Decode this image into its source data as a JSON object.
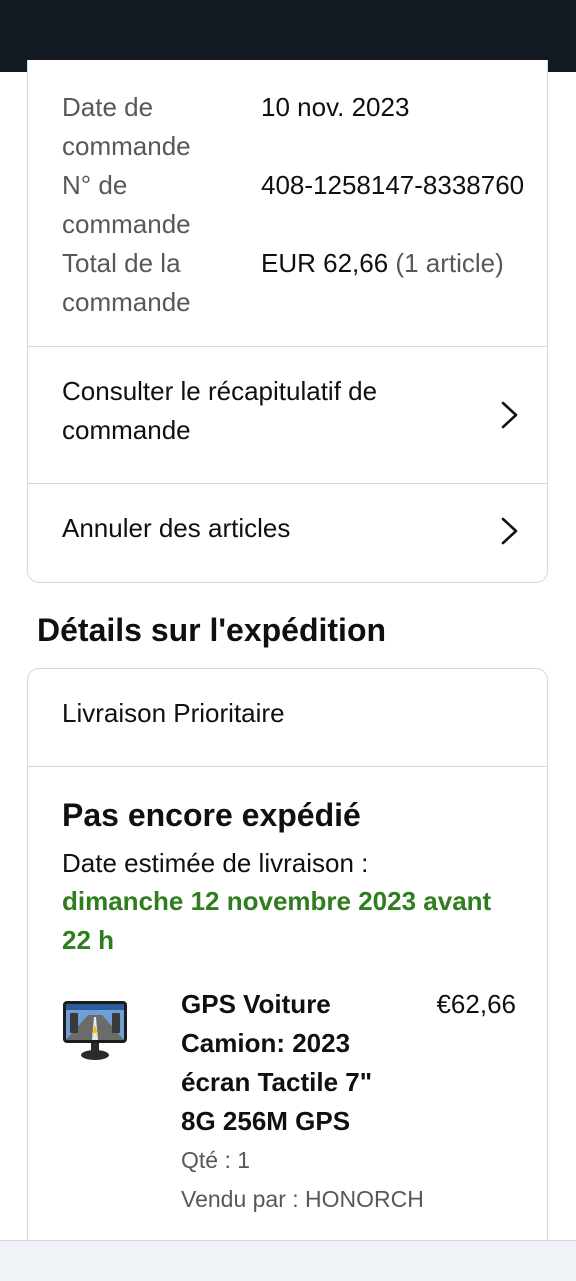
{
  "order": {
    "rows": [
      {
        "label": "Date de commande",
        "value": "10 nov. 2023",
        "value_suffix": ""
      },
      {
        "label": "N° de commande",
        "value": "408-1258147-8338760",
        "value_suffix": ""
      },
      {
        "label": "Total de la commande",
        "value": "EUR 62,66",
        "value_suffix": " (1 article)"
      }
    ],
    "links": [
      {
        "label": "Consulter le récapitulatif de commande",
        "icon": "chevron-right-icon"
      },
      {
        "label": "Annuler des articles",
        "icon": "chevron-right-icon"
      }
    ]
  },
  "shipping": {
    "section_title": "Détails sur l'expédition",
    "method": "Livraison Prioritaire",
    "status": "Pas encore expédié",
    "estimate_label": "Date estimée de livraison :",
    "estimate_date": "dimanche 12 novembre 2023 avant 22 h",
    "product": {
      "name": "GPS Voiture Camion: 2023 écran Tactile 7\" 8G 256M GPS",
      "price": "€62,66",
      "qty": "Qté : 1",
      "seller": "Vendu par : HONORCH",
      "image_icon": "gps-device-image"
    }
  },
  "colors": {
    "header": "#131921",
    "delivery_date": "#2f7d1f",
    "muted_text": "#565959",
    "border": "#d5d9d9"
  }
}
